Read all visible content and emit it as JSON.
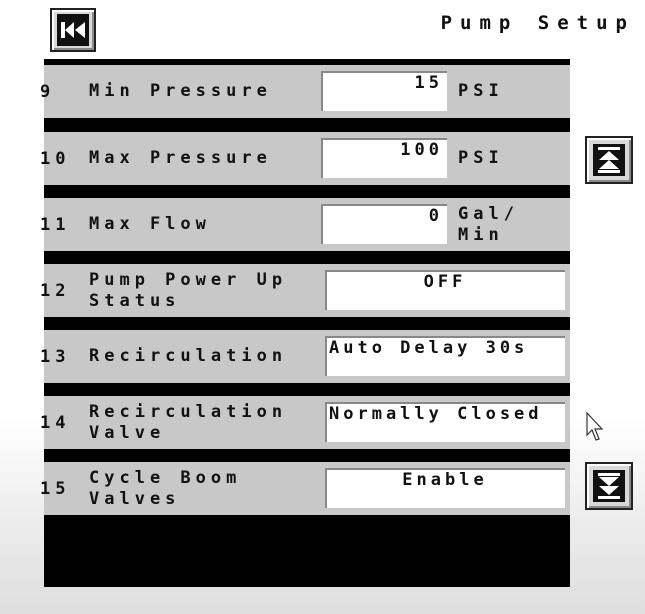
{
  "header": {
    "title": "Pump Setup",
    "back_icon": "skip-back-icon"
  },
  "nav": {
    "up_icon": "scroll-to-top-icon",
    "down_icon": "scroll-to-bottom-icon"
  },
  "rows": [
    {
      "num": "9",
      "label_lines": [
        "Min Pressure"
      ],
      "value": "15",
      "unit_lines": [
        "PSI"
      ]
    },
    {
      "num": "10",
      "label_lines": [
        "Max Pressure"
      ],
      "value": "100",
      "unit_lines": [
        "PSI"
      ]
    },
    {
      "num": "11",
      "label_lines": [
        "Max Flow"
      ],
      "value": "0",
      "unit_lines": [
        "Gal/",
        "Min"
      ]
    },
    {
      "num": "12",
      "label_lines": [
        "Pump Power Up",
        "Status"
      ],
      "value": "OFF",
      "unit_lines": []
    },
    {
      "num": "13",
      "label_lines": [
        "Recirculation"
      ],
      "value": "Auto Delay 30s",
      "unit_lines": []
    },
    {
      "num": "14",
      "label_lines": [
        "Recirculation",
        "Valve"
      ],
      "value": "Normally Closed",
      "unit_lines": []
    },
    {
      "num": "15",
      "label_lines": [
        "Cycle Boom",
        "Valves"
      ],
      "value": "Enable",
      "unit_lines": []
    }
  ],
  "colors": {
    "panel_background": "#000000",
    "row_background": "#c8c8c8",
    "field_background": "#ffffff"
  }
}
